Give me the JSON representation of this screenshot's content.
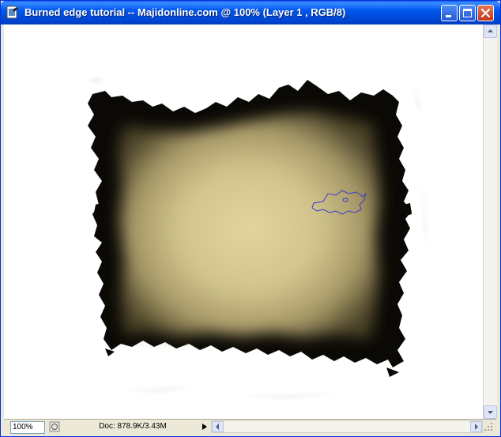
{
  "window": {
    "title": "Burned edge tutorial -- Majidonline.com @ 100% (Layer 1 , RGB/8)",
    "icon": "photoshop-document-icon",
    "buttons": [
      "minimize",
      "maximize",
      "close"
    ]
  },
  "statusbar": {
    "zoom": "100%",
    "doc_info": "Doc: 878.9K/3.43M"
  },
  "colors": {
    "titlebar": "#0054e3",
    "parchment_center": "#e0d39a",
    "parchment_edge": "#8a7c52",
    "burn": "#0a0804",
    "selection": "#3a3ad0"
  }
}
